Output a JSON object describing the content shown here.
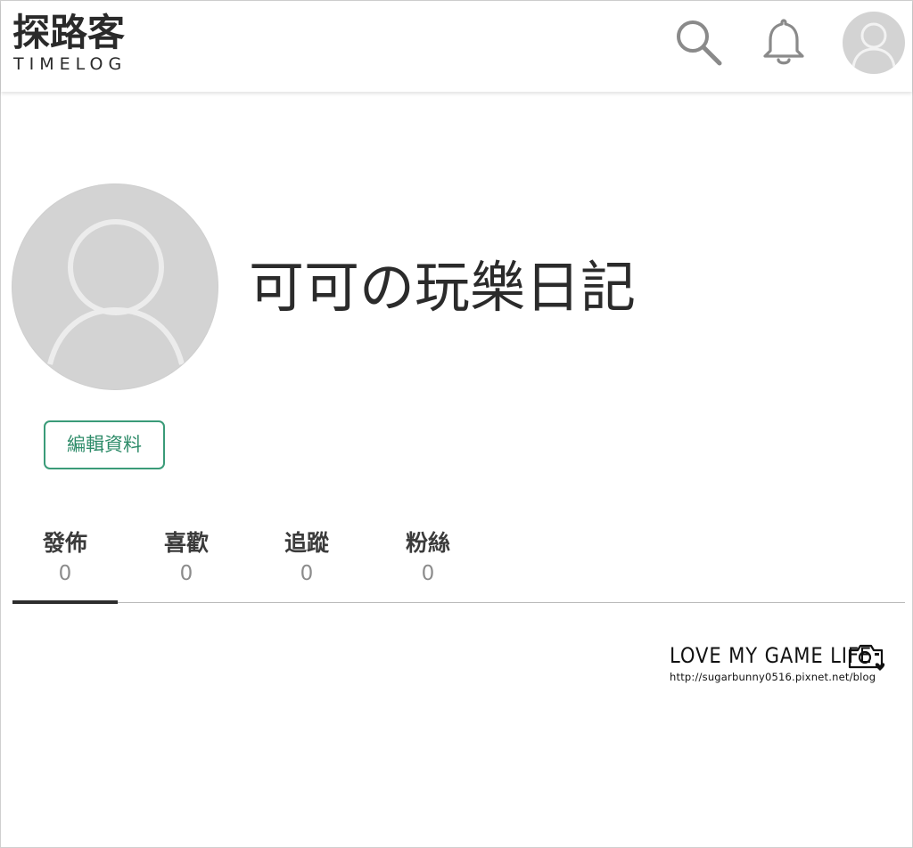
{
  "header": {
    "logo_cn": "探路客",
    "logo_en": "TIMELOG",
    "search_icon": "search-icon",
    "bell_icon": "bell-icon",
    "avatar_icon": "user-avatar-icon"
  },
  "profile": {
    "name": "可可の玩樂日記",
    "edit_button": "編輯資料"
  },
  "tabs": [
    {
      "label": "發佈",
      "count": "0",
      "active": true
    },
    {
      "label": "喜歡",
      "count": "0",
      "active": false
    },
    {
      "label": "追蹤",
      "count": "0",
      "active": false
    },
    {
      "label": "粉絲",
      "count": "0",
      "active": false
    }
  ],
  "watermark": {
    "title": "LOVE MY GAME LIFE",
    "url": "http://sugarbunny0516.pixnet.net/blog"
  },
  "colors": {
    "accent": "#3a9b78",
    "avatar_bg": "#d3d3d3",
    "text": "#2b2b2b"
  }
}
